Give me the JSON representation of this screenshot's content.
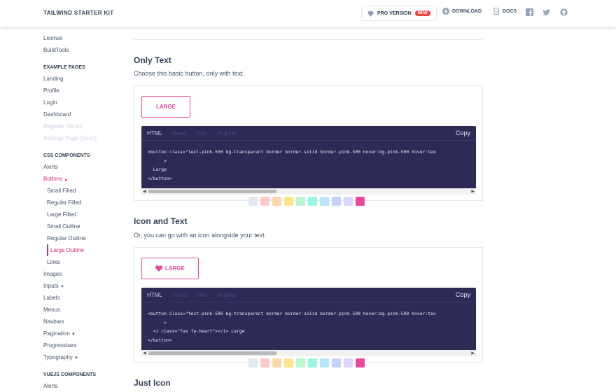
{
  "header": {
    "brand": "TAILWIND STARTER KIT",
    "pro_label": "PRO VERSION",
    "pro_badge": "NEW",
    "download": "DOWNLOAD",
    "docs": "DOCS"
  },
  "sidebar": {
    "top_items": [
      "License",
      "BuildTools"
    ],
    "example_heading": "EXAMPLE PAGES",
    "example_items": [
      "Landing",
      "Profile",
      "Login",
      "Dashboard"
    ],
    "example_disabled": [
      "Register (Soon)",
      "Settings Page (Soon)"
    ],
    "css_heading": "CSS COMPONENTS",
    "alerts": "Alerts",
    "buttons": "Buttons",
    "button_subitems": [
      "Small Filled",
      "Regular Filled",
      "Large Filled",
      "Small Outline",
      "Regular Outline"
    ],
    "button_active": "Large Outline",
    "links": "Links",
    "images": "Images",
    "inputs": "Inputs",
    "labels": "Labels",
    "menus": "Menus",
    "navbars": "Navbars",
    "pagination": "Pagination",
    "progressbars": "Progressbars",
    "typography": "Typography",
    "vue_heading": "VUEJS COMPONENTS",
    "vue_alerts": "Alerts"
  },
  "sections": {
    "only_text": {
      "title": "Only Text",
      "desc": "Choose this basic button, only with text.",
      "button": "LARGE",
      "code": "<button class=\"text-pink-500 bg-transparent border border-solid border-pink-500 hover:bg-pink-500 hover:tex\n      >\n  Large\n</button>"
    },
    "icon_text": {
      "title": "Icon and Text",
      "desc": "Or, you can go with an icon alongside your text.",
      "button": "LARGE",
      "code": "<button class=\"text-pink-500 bg-transparent border border-solid border-pink-500 hover:bg-pink-500 hover:tex\n      >\n  <i class=\"fas fa-heart\"></i> Large\n</button>"
    },
    "just_icon": {
      "title": "Just Icon"
    }
  },
  "code_tabs": [
    "HTML",
    "React",
    "Vue",
    "Angular"
  ],
  "copy_label": "Copy",
  "swatch_colors": [
    "#e2e8f0",
    "#fecaca",
    "#fed7aa",
    "#fde68a",
    "#bbf7d0",
    "#99f6e4",
    "#bae6fd",
    "#c7d2fe",
    "#ddd6fe",
    "#ec4899"
  ],
  "accent": "#ec4899"
}
